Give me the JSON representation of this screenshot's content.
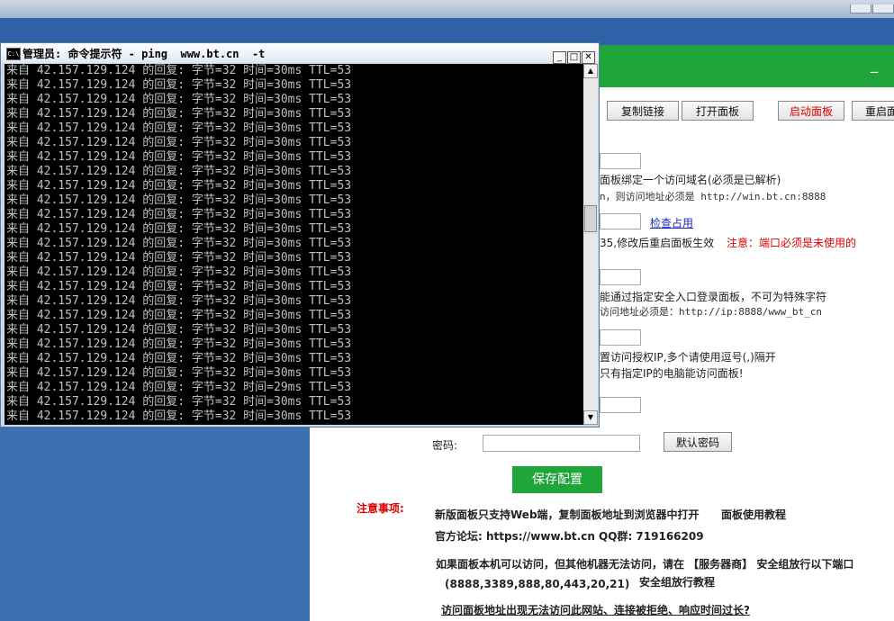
{
  "cmd": {
    "title": "管理员: 命令提示符 - ping  www.bt.cn  -t",
    "icon_label": "C:\\",
    "lines": [
      "来自 42.157.129.124 的回复: 字节=32 时间=30ms TTL=53",
      "来自 42.157.129.124 的回复: 字节=32 时间=30ms TTL=53",
      "来自 42.157.129.124 的回复: 字节=32 时间=30ms TTL=53",
      "来自 42.157.129.124 的回复: 字节=32 时间=30ms TTL=53",
      "来自 42.157.129.124 的回复: 字节=32 时间=30ms TTL=53",
      "来自 42.157.129.124 的回复: 字节=32 时间=30ms TTL=53",
      "来自 42.157.129.124 的回复: 字节=32 时间=30ms TTL=53",
      "来自 42.157.129.124 的回复: 字节=32 时间=30ms TTL=53",
      "来自 42.157.129.124 的回复: 字节=32 时间=30ms TTL=53",
      "来自 42.157.129.124 的回复: 字节=32 时间=30ms TTL=53",
      "来自 42.157.129.124 的回复: 字节=32 时间=30ms TTL=53",
      "来自 42.157.129.124 的回复: 字节=32 时间=30ms TTL=53",
      "来自 42.157.129.124 的回复: 字节=32 时间=30ms TTL=53",
      "来自 42.157.129.124 的回复: 字节=32 时间=30ms TTL=53",
      "来自 42.157.129.124 的回复: 字节=32 时间=30ms TTL=53",
      "来自 42.157.129.124 的回复: 字节=32 时间=30ms TTL=53",
      "来自 42.157.129.124 的回复: 字节=32 时间=30ms TTL=53",
      "来自 42.157.129.124 的回复: 字节=32 时间=30ms TTL=53",
      "来自 42.157.129.124 的回复: 字节=32 时间=30ms TTL=53",
      "来自 42.157.129.124 的回复: 字节=32 时间=30ms TTL=53",
      "来自 42.157.129.124 的回复: 字节=32 时间=30ms TTL=53",
      "来自 42.157.129.124 的回复: 字节=32 时间=30ms TTL=53",
      "来自 42.157.129.124 的回复: 字节=32 时间=29ms TTL=53",
      "来自 42.157.129.124 的回复: 字节=32 时间=30ms TTL=53",
      "来自 42.157.129.124 的回复: 字节=32 时间=30ms TTL=53"
    ]
  },
  "panel": {
    "minimize": "_",
    "buttons": {
      "copy_link": "复制链接",
      "open_panel": "打开面板",
      "start_panel": "启动面板",
      "restart_panel": "重启面"
    },
    "domain_hint": "面板绑定一个访问域名(必须是已解析)",
    "domain_example": "n，则访问地址必须是 http://win.bt.cn:8888",
    "check_port": "检查占用",
    "port_hint": "35,修改后重启面板生效",
    "port_warning": "注意：端口必须是未使用的",
    "entry_hint": "能通过指定安全入口登录面板，不可为特殊字符",
    "entry_example": "访问地址必须是：http://ip:8888/www_bt_cn",
    "ip_hint": "置访问授权IP,多个请使用逗号(,)隔开",
    "ip_hint2": "只有指定IP的电脑能访问面板!",
    "password_label": "密码:",
    "default_password": "默认密码",
    "save": "保存配置",
    "notes_title": "注意事项:",
    "note1": "新版面板只支持Web端，复制面板地址到浏览器中打开",
    "note1_link": "面板使用教程",
    "note2": "官方论坛: https://www.bt.cn  QQ群: 719166209",
    "note3": "如果面板本机可以访问，但其他机器无法访问，请在 【服务器商】 安全组放行以下端口",
    "note4": "(8888,3389,888,80,443,20,21)",
    "note4_link": "安全组放行教程",
    "bottom_link": "访问面板地址出现无法访问此网站、连接被拒绝、响应时间过长?"
  }
}
